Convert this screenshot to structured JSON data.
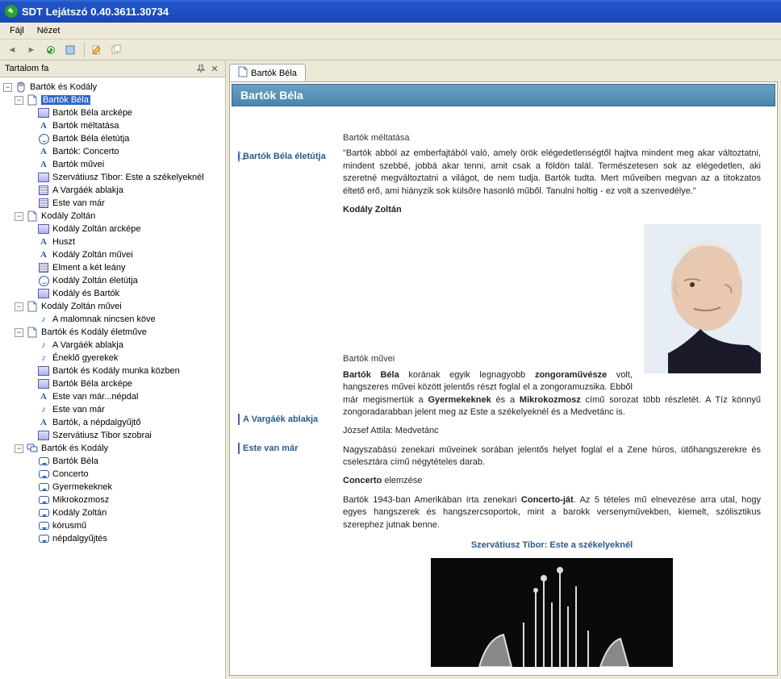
{
  "window": {
    "title": "SDT Lejátszó 0.40.3611.30734"
  },
  "menu": {
    "file": "Fájl",
    "view": "Nézet"
  },
  "sidebar": {
    "title": "Tartalom fa",
    "tree": {
      "root": {
        "label": "Bartók és Kodály",
        "children": [
          {
            "label": "Bartók Béla",
            "selected": true,
            "items": [
              {
                "icon": "img",
                "label": "Bartók Béla arcképe"
              },
              {
                "icon": "A",
                "label": "Bartók méltatása"
              },
              {
                "icon": "smile",
                "label": "Bartók Béla életútja"
              },
              {
                "icon": "A",
                "label": "Bartók: Concerto"
              },
              {
                "icon": "A",
                "label": "Bartók művei"
              },
              {
                "icon": "img",
                "label": "Szervátiusz Tibor: Este a székelyeknél"
              },
              {
                "icon": "text",
                "label": "A Vargáék ablakja"
              },
              {
                "icon": "text",
                "label": "Este van már"
              }
            ]
          },
          {
            "label": "Kodály Zoltán",
            "items": [
              {
                "icon": "img",
                "label": "Kodály Zoltán arcképe"
              },
              {
                "icon": "A",
                "label": "Huszt"
              },
              {
                "icon": "A",
                "label": "Kodály Zoltán művei"
              },
              {
                "icon": "text",
                "label": "Elment a két leány"
              },
              {
                "icon": "smile",
                "label": "Kodály Zoltán életútja"
              },
              {
                "icon": "img",
                "label": "Kodály és Bartók"
              }
            ]
          },
          {
            "label": "Kodály Zoltán művei",
            "items": [
              {
                "icon": "note",
                "label": "A malomnak nincsen köve"
              }
            ]
          },
          {
            "label": "Bartók és Kodály életműve",
            "items": [
              {
                "icon": "note",
                "label": "A Vargáék ablakja"
              },
              {
                "icon": "note",
                "label": "Éneklő gyerekek"
              },
              {
                "icon": "img",
                "label": "Bartók és Kodály munka közben"
              },
              {
                "icon": "img",
                "label": "Bartók Béla arcképe"
              },
              {
                "icon": "A",
                "label": "Este van már...népdal"
              },
              {
                "icon": "note",
                "label": "Este van már"
              },
              {
                "icon": "A",
                "label": "Bartók, a népdalgyűjtő"
              },
              {
                "icon": "img",
                "label": "Szervátiusz Tibor szobrai"
              }
            ]
          },
          {
            "label": "Bartók és Kodály",
            "iconOverride": "bubble-branch",
            "items": [
              {
                "icon": "bubble",
                "label": "Bartók Béla"
              },
              {
                "icon": "bubble",
                "label": "Concerto"
              },
              {
                "icon": "bubble",
                "label": "Gyermekeknek"
              },
              {
                "icon": "bubble",
                "label": "Mikrokozmosz"
              },
              {
                "icon": "bubble",
                "label": "Kodály Zoltán"
              },
              {
                "icon": "bubble",
                "label": "kórusmű"
              },
              {
                "icon": "bubble",
                "label": "népdalgyűjtés"
              }
            ]
          }
        ]
      }
    }
  },
  "tab": {
    "label": "Bartók Béla"
  },
  "content": {
    "banner": "Bartók Béla",
    "sidelinks": {
      "l1": "Bartók Béla életútja",
      "l2": "A Vargáék ablakja",
      "l3": "Este van már"
    },
    "sec1_label": "Bartók méltatása",
    "sec1_quote": "\"Bartók abból az emberfajtából való, amely örök elégedetlenségtől hajtva mindent meg akar változtatni, mindent szebbé, jobbá akar tenni, amit csak a földön talál. Természetesen sok az elégedetlen, aki szeretné megváltoztatni a világot, de nem tudja. Bartók tudta. Mert műveiben megvan az a titokzatos éltető erő, ami hiányzik sok külsőre hasonló műből. Tanulni holtig - ez volt a szenvedélye.\"",
    "sec1_author": "Kodály Zoltán",
    "sec2_label": "Bartók művei",
    "sec2_p1_pre": "Bartók Béla",
    "sec2_p1_mid1": " korának egyik legnagyobb ",
    "sec2_p1_b1": "zongoraművésze",
    "sec2_p1_mid2": " volt, hangszeres művei között jelentős részt foglal el a zongoramuzsika. Ebből már megismertük a ",
    "sec2_p1_b2": "Gyermekeknek",
    "sec2_p1_mid3": " és a ",
    "sec2_p1_b3": "Mikrokozmosz",
    "sec2_p1_end": " című sorozat több részletét. A Tíz könnyű zongoradarabban jelent meg az Este a székelyeknél és a Medvetánc is.",
    "sec2_p2": "József Attila: Medvetánc",
    "sec2_p3": "Nagyszabású zenekari műveinek sorában jelentős helyet foglal el a Zene húros, ütőhangszerekre és cselesztára című négytételes darab.",
    "sec2_p4_b": "Concerto",
    "sec2_p4_rest": " elemzése",
    "sec2_p5_pre": "Bartók 1943-ban Amerikában írta zenekari ",
    "sec2_p5_b": "Concerto-ját",
    "sec2_p5_end": ". Az 5 tételes mű elnevezése arra utal, hogy egyes hangszerek és hangszercsoportok, mint a barokk versenyművekben, kiemelt, szólisztikus szerephez jutnak benne.",
    "artwork_title": "Szervátiusz Tibor: Este a székelyeknél"
  }
}
